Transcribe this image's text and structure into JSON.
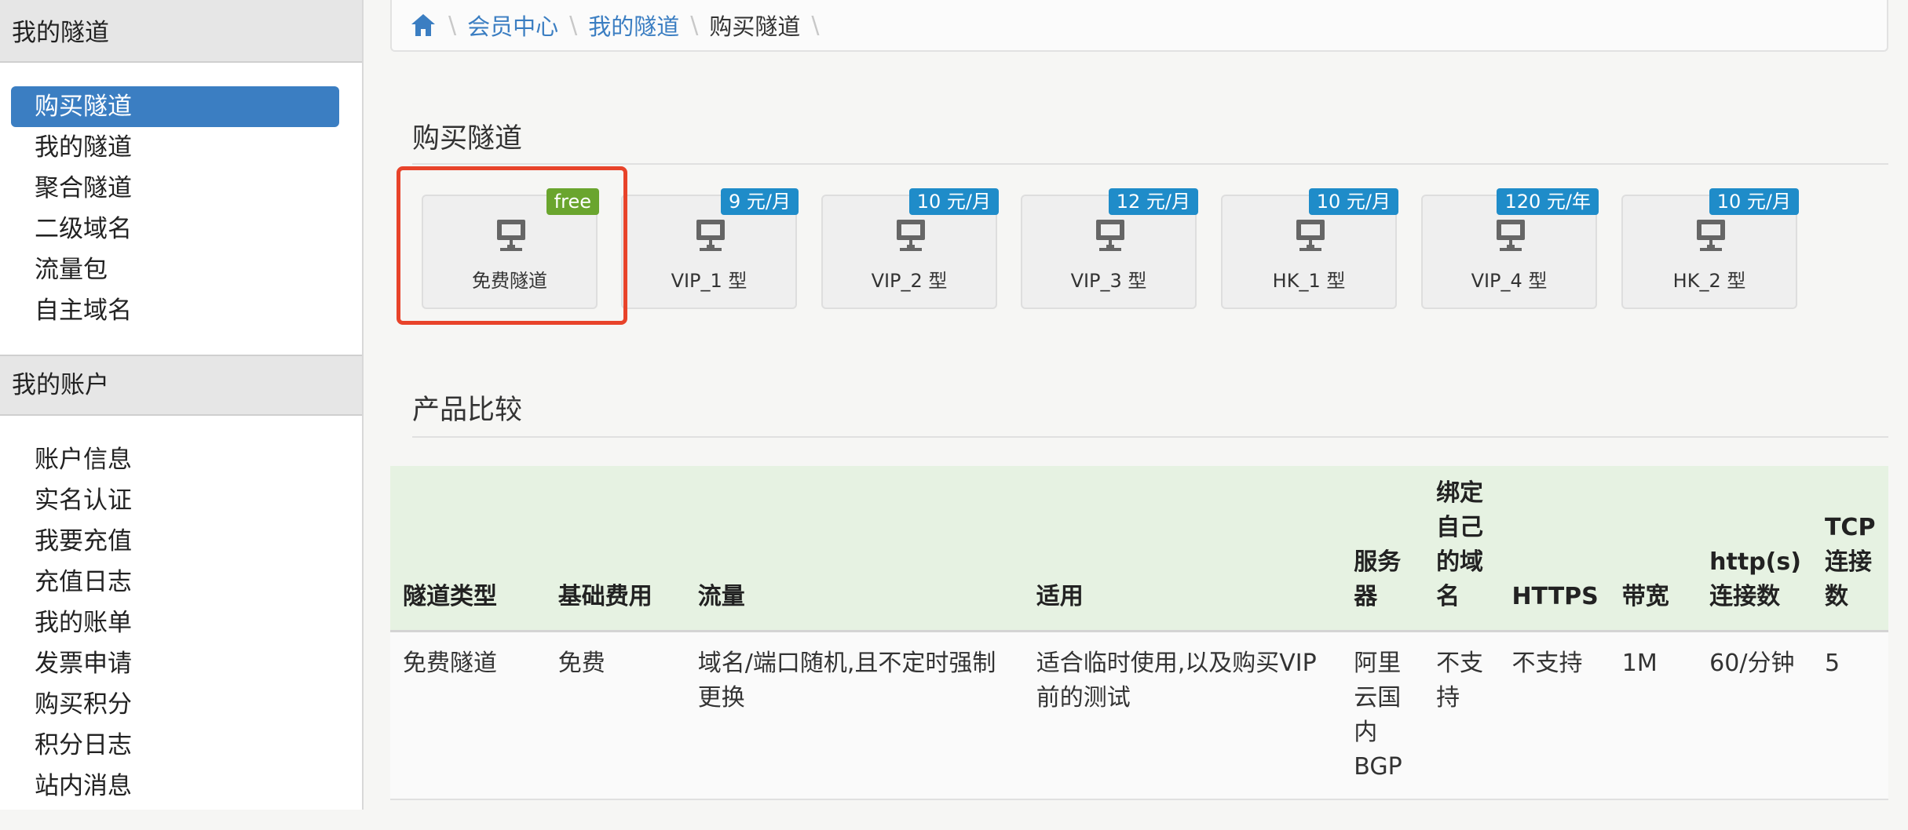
{
  "sidebar": {
    "tunnels_header": "我的隧道",
    "tunnel_items": [
      "购买隧道",
      "我的隧道",
      "聚合隧道",
      "二级域名",
      "流量包",
      "自主域名"
    ],
    "account_header": "我的账户",
    "account_items": [
      "账户信息",
      "实名认证",
      "我要充值",
      "充值日志",
      "我的账单",
      "发票申请",
      "购买积分",
      "积分日志",
      "站内消息"
    ]
  },
  "breadcrumb": {
    "home_icon": "home-icon",
    "items": [
      "会员中心",
      "我的隧道",
      "购买隧道"
    ]
  },
  "buy_section": {
    "title": "购买隧道",
    "cards": [
      {
        "label": "免费隧道",
        "badge": "free",
        "badge_color": "#6aa52e"
      },
      {
        "label": "VIP_1 型",
        "badge": "9 元/月",
        "badge_color": "#1f8cc9"
      },
      {
        "label": "VIP_2 型",
        "badge": "10 元/月",
        "badge_color": "#1f8cc9"
      },
      {
        "label": "VIP_3 型",
        "badge": "12 元/月",
        "badge_color": "#1f8cc9"
      },
      {
        "label": "HK_1 型",
        "badge": "10 元/月",
        "badge_color": "#1f8cc9"
      },
      {
        "label": "VIP_4 型",
        "badge": "120 元/年",
        "badge_color": "#1f8cc9"
      },
      {
        "label": "HK_2 型",
        "badge": "10 元/月",
        "badge_color": "#1f8cc9"
      }
    ]
  },
  "compare_section": {
    "title": "产品比较",
    "headers": [
      "隧道类型",
      "基础费用",
      "流量",
      "适用",
      "服务器",
      "绑定自己的域名",
      "HTTPS",
      "带宽",
      "http(s)连接数",
      "TCP连接数"
    ],
    "rows": [
      [
        "免费隧道",
        "免费",
        "域名/端口随机,且不定时强制更换",
        "适合临时使用,以及购买VIP前的测试",
        "阿里云国内BGP",
        "不支持",
        "不支持",
        "1M",
        "60/分钟",
        "5"
      ]
    ]
  },
  "colors": {
    "accent": "#3b7ec2",
    "highlight": "#e8432a"
  }
}
